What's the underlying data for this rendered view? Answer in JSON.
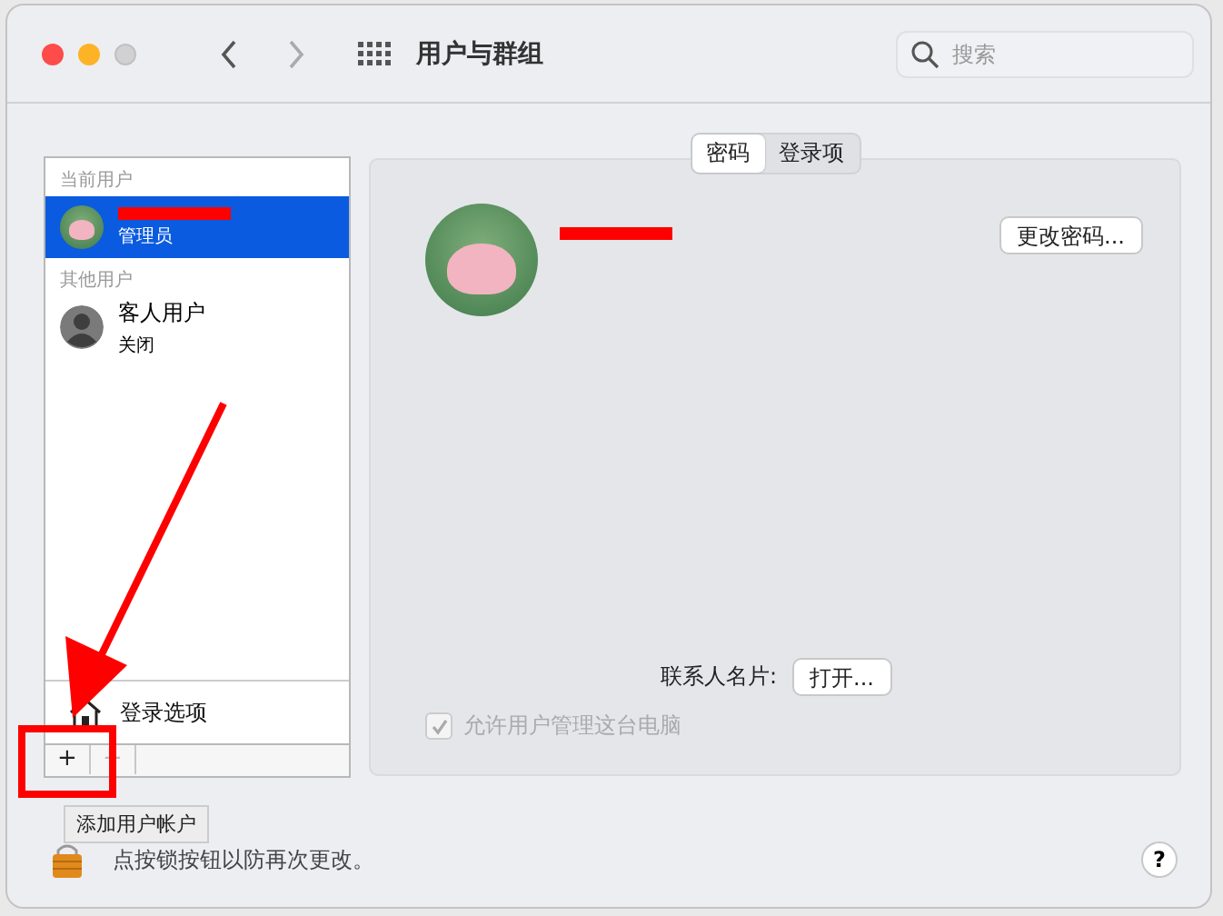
{
  "window": {
    "title": "用户与群组"
  },
  "search": {
    "placeholder": "搜索"
  },
  "user_list": {
    "sections": [
      {
        "heading": "当前用户",
        "users": [
          {
            "kind": "photo",
            "name_redacted": true,
            "role": "管理员",
            "selected": true
          }
        ]
      },
      {
        "heading": "其他用户",
        "users": [
          {
            "kind": "silhouette",
            "name": "客人用户",
            "role": "关闭",
            "selected": false
          }
        ]
      }
    ],
    "login_options": "登录选项",
    "add_button": "+",
    "remove_button": {
      "label": "−",
      "disabled": true
    }
  },
  "tabs": [
    {
      "label": "密码",
      "selected": true
    },
    {
      "label": "登录项",
      "selected": false
    }
  ],
  "detail": {
    "change_password_button": "更改密码...",
    "contact_card_label": "联系人名片:",
    "open_button": "打开...",
    "allow_admin": {
      "label": "允许用户管理这台电脑",
      "checked": true,
      "disabled": true
    }
  },
  "tooltip": "添加用户帐户",
  "lock_message": "点按锁按钮以防再次更改。",
  "help_button": "?"
}
